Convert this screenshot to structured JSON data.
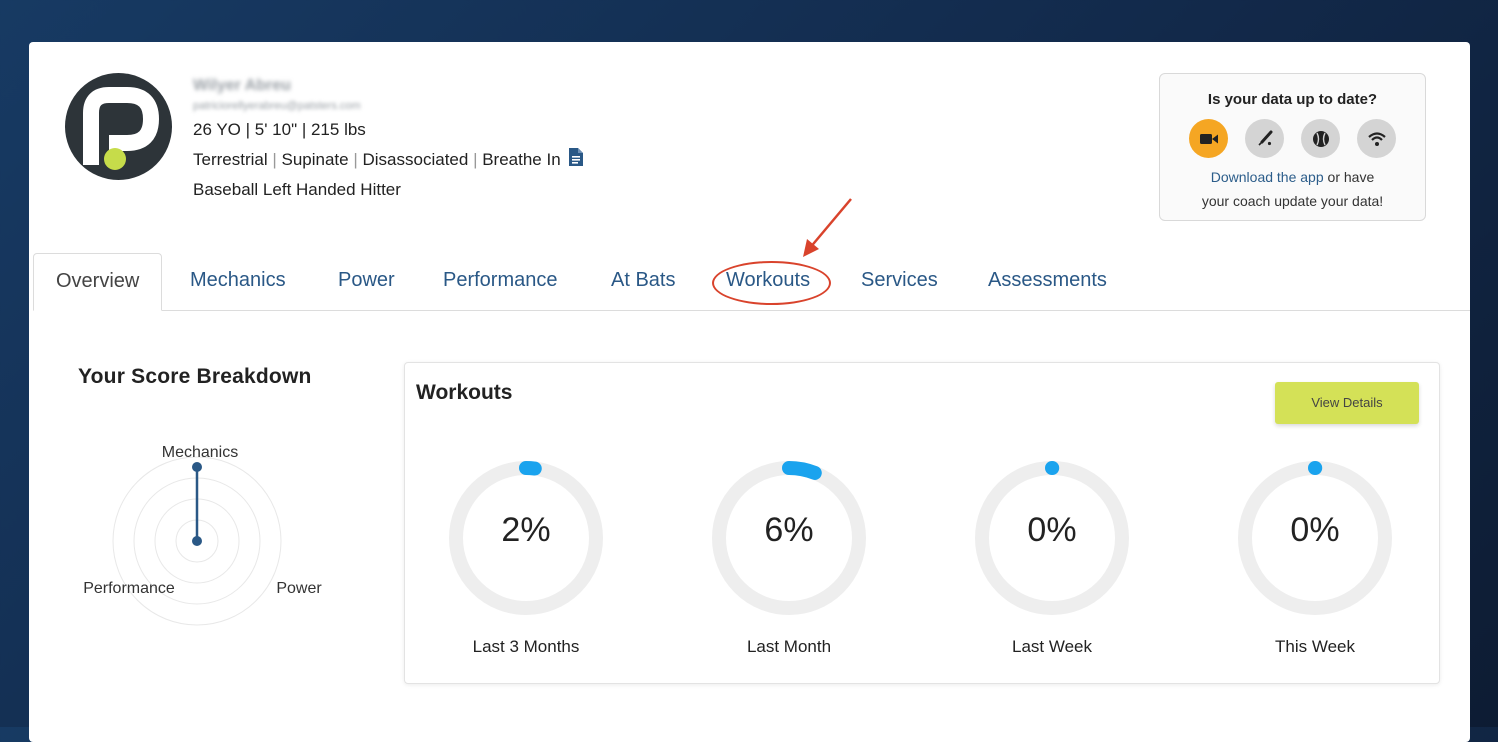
{
  "profile": {
    "name": "Wilyer Abreu",
    "email": "patriciorellyerabreu@patsters.com",
    "stats": "26 YO | 5' 10\" | 215 lbs",
    "traits": [
      "Terrestrial",
      "Supinate",
      "Disassociated",
      "Breathe In"
    ],
    "sport": "Baseball Left Handed Hitter"
  },
  "data_status": {
    "question": "Is your data up to date?",
    "icons": [
      "video-camera-icon",
      "bat-icon",
      "baseball-icon",
      "wifi-sensor-icon"
    ],
    "link_text": "Download the app",
    "note_mid": " or have",
    "note_end": "your coach update your data!"
  },
  "tabs": [
    {
      "label": "Overview",
      "active": true
    },
    {
      "label": "Mechanics"
    },
    {
      "label": "Power"
    },
    {
      "label": "Performance"
    },
    {
      "label": "At Bats"
    },
    {
      "label": "Workouts"
    },
    {
      "label": "Services"
    },
    {
      "label": "Assessments"
    }
  ],
  "score": {
    "title": "Your Score Breakdown",
    "axes": [
      "Mechanics",
      "Performance",
      "Power"
    ]
  },
  "workouts": {
    "title": "Workouts",
    "button": "View Details",
    "gauges": [
      {
        "label": "Last 3 Months",
        "pct_text": "2%",
        "value": 2
      },
      {
        "label": "Last Month",
        "pct_text": "6%",
        "value": 6
      },
      {
        "label": "Last Week",
        "pct_text": "0%",
        "value": 0
      },
      {
        "label": "This Week",
        "pct_text": "0%",
        "value": 0
      }
    ]
  },
  "colors": {
    "accent_blue": "#2a5886",
    "gauge_fill": "#1aa3ee",
    "gauge_track": "#eeeeee",
    "button_green": "#d4e157",
    "active_icon": "#f5a623",
    "annotation": "#d9432c"
  }
}
